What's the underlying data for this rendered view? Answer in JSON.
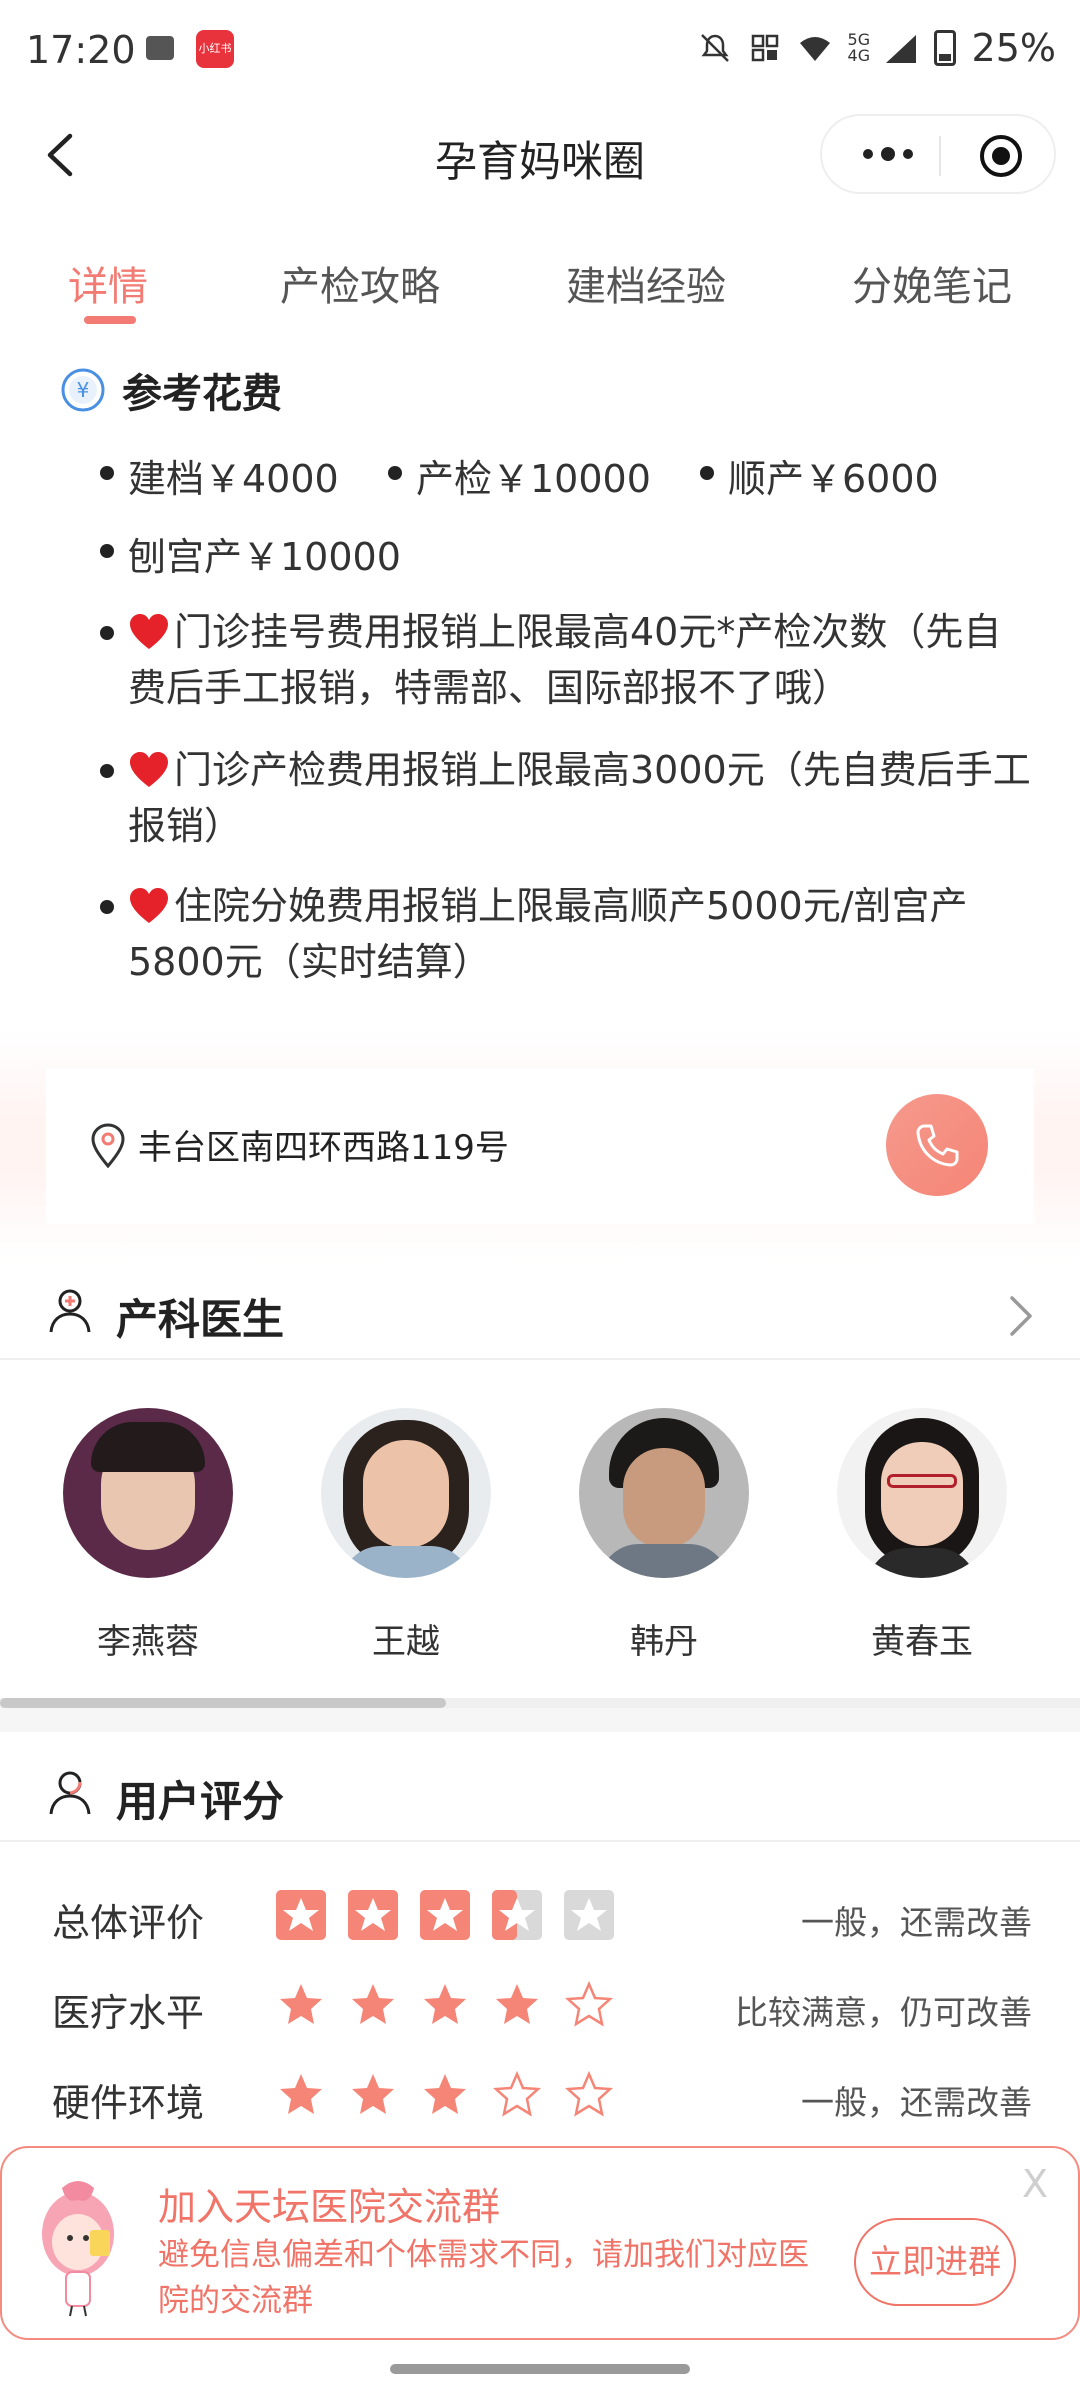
{
  "status_bar": {
    "time": "17:20",
    "app_badge": "小红书",
    "network": "5G 4G",
    "battery": "25%"
  },
  "nav": {
    "title": "孕育妈咪圈"
  },
  "tabs": [
    {
      "label": "详情"
    },
    {
      "label": "产检攻略"
    },
    {
      "label": "建档经验"
    },
    {
      "label": "分娩笔记"
    }
  ],
  "cost": {
    "title": "参考花费",
    "items_row1": [
      "建档￥4000",
      "产检￥10000",
      "顺产￥6000"
    ],
    "item_csection": "刨宫产￥10000",
    "notes": [
      "门诊挂号费用报销上限最高40元*产检次数（先自费后手工报销，特需部、国际部报不了哦）",
      "门诊产检费用报销上限最高3000元（先自费后手工报销）",
      "住院分娩费用报销上限最高顺产5000元/剖宫产5800元（实时结算）"
    ]
  },
  "address": {
    "text": "丰台区南四环西路119号"
  },
  "doctors": {
    "title": "产科医生",
    "list": [
      {
        "name": "李燕蓉"
      },
      {
        "name": "王越"
      },
      {
        "name": "韩丹"
      },
      {
        "name": "黄春玉"
      }
    ]
  },
  "ratings": {
    "title": "用户评分",
    "rows": [
      {
        "label": "总体评价",
        "stars": 3.5,
        "desc": "一般，还需改善"
      },
      {
        "label": "医疗水平",
        "stars": 4,
        "desc": "比较满意，仍可改善"
      },
      {
        "label": "硬件环境",
        "stars": 3,
        "desc": "一般，还需改善"
      }
    ]
  },
  "banner": {
    "title": "加入天坛医院交流群",
    "desc": "避免信息偏差和个体需求不同，请加我们对应医院的交流群",
    "button": "立即进群",
    "close": "X"
  },
  "colors": {
    "accent": "#f27b73",
    "star_fill": "#f58576",
    "star_empty": "#f58576"
  }
}
